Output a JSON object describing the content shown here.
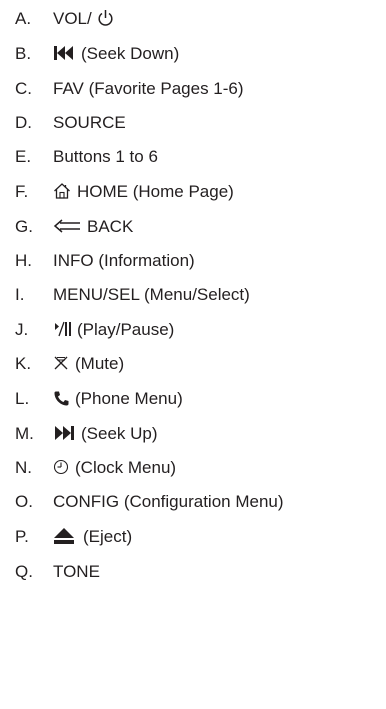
{
  "legend": {
    "items": [
      {
        "letter": "A.",
        "text": "VOL/",
        "icon": "power-icon",
        "icon_after": true
      },
      {
        "letter": "B.",
        "text": "(Seek Down)",
        "icon": "seek-down-icon"
      },
      {
        "letter": "C.",
        "text": "FAV (Favorite Pages 1-6)",
        "icon": ""
      },
      {
        "letter": "D.",
        "text": "SOURCE",
        "icon": ""
      },
      {
        "letter": "E.",
        "text": "Buttons 1 to 6",
        "icon": ""
      },
      {
        "letter": "F.",
        "text": "HOME (Home Page)",
        "icon": "home-icon"
      },
      {
        "letter": "G.",
        "text": "BACK",
        "icon": "back-arrow-icon"
      },
      {
        "letter": "H.",
        "text": "INFO (Information)",
        "icon": ""
      },
      {
        "letter": "I.",
        "text": "MENU/SEL (Menu/Select)",
        "icon": ""
      },
      {
        "letter": "J.",
        "text": "(Play/Pause)",
        "icon": "play-pause-icon"
      },
      {
        "letter": "K.",
        "text": "(Mute)",
        "icon": "mute-icon"
      },
      {
        "letter": "L.",
        "text": "(Phone Menu)",
        "icon": "phone-icon"
      },
      {
        "letter": "M.",
        "text": "(Seek Up)",
        "icon": "seek-up-icon"
      },
      {
        "letter": "N.",
        "text": "(Clock Menu)",
        "icon": "clock-icon"
      },
      {
        "letter": "O.",
        "text": "CONFIG (Configuration Menu)",
        "icon": ""
      },
      {
        "letter": "P.",
        "text": "(Eject)",
        "icon": "eject-icon"
      },
      {
        "letter": "Q.",
        "text": "TONE",
        "icon": ""
      }
    ]
  }
}
